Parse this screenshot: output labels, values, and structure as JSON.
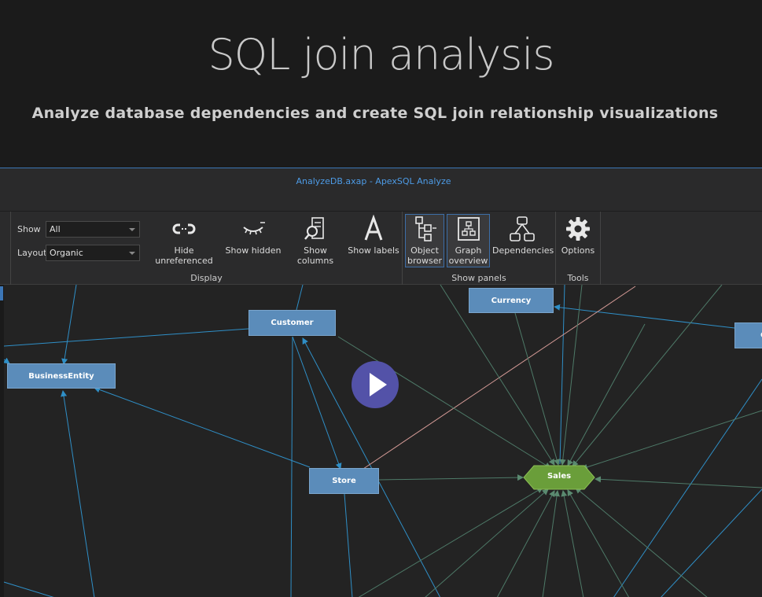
{
  "hero": {
    "title": "SQL join analysis",
    "subtitle": "Analyze database dependencies and create SQL join relationship visualizations"
  },
  "window": {
    "title": "AnalyzeDB.axap - ApexSQL Analyze"
  },
  "ribbon": {
    "display": {
      "group_label": "Display",
      "show_label": "Show",
      "show_value": "All",
      "layout_label": "Layout",
      "layout_value": "Organic",
      "hide_unreferenced": "Hide unreferenced",
      "show_hidden": "Show hidden",
      "show_columns": "Show columns",
      "show_labels": "Show labels"
    },
    "panels": {
      "group_label": "Show panels",
      "object_browser_1": "Object",
      "object_browser_2": "browser",
      "graph_overview_1": "Graph",
      "graph_overview_2": "overview",
      "dependencies": "Dependencies"
    },
    "tools": {
      "group_label": "Tools",
      "options": "Options"
    }
  },
  "graph": {
    "nodes": {
      "currency": "Currency",
      "customer": "Customer",
      "business_entity": "BusinessEntity",
      "store": "Store",
      "sales": "Sales",
      "right_partial": "C"
    }
  },
  "colors": {
    "accent": "#3c76b6",
    "node_fill": "#5b8cba",
    "sales_fill": "#6a9e3a",
    "edge_blue": "#2f8fc7",
    "edge_green": "#4e7a68",
    "edge_pink": "#d49a96",
    "play_button": "#5352a8"
  },
  "icons": {
    "hide_unreferenced": "unlink-icon",
    "show_hidden": "closed-eye-icon",
    "show_columns": "document-search-icon",
    "show_labels": "letter-a-icon",
    "object_browser": "tree-icon",
    "graph_overview": "overview-icon",
    "dependencies": "hierarchy-icon",
    "options": "gear-icon",
    "play": "play-icon"
  }
}
